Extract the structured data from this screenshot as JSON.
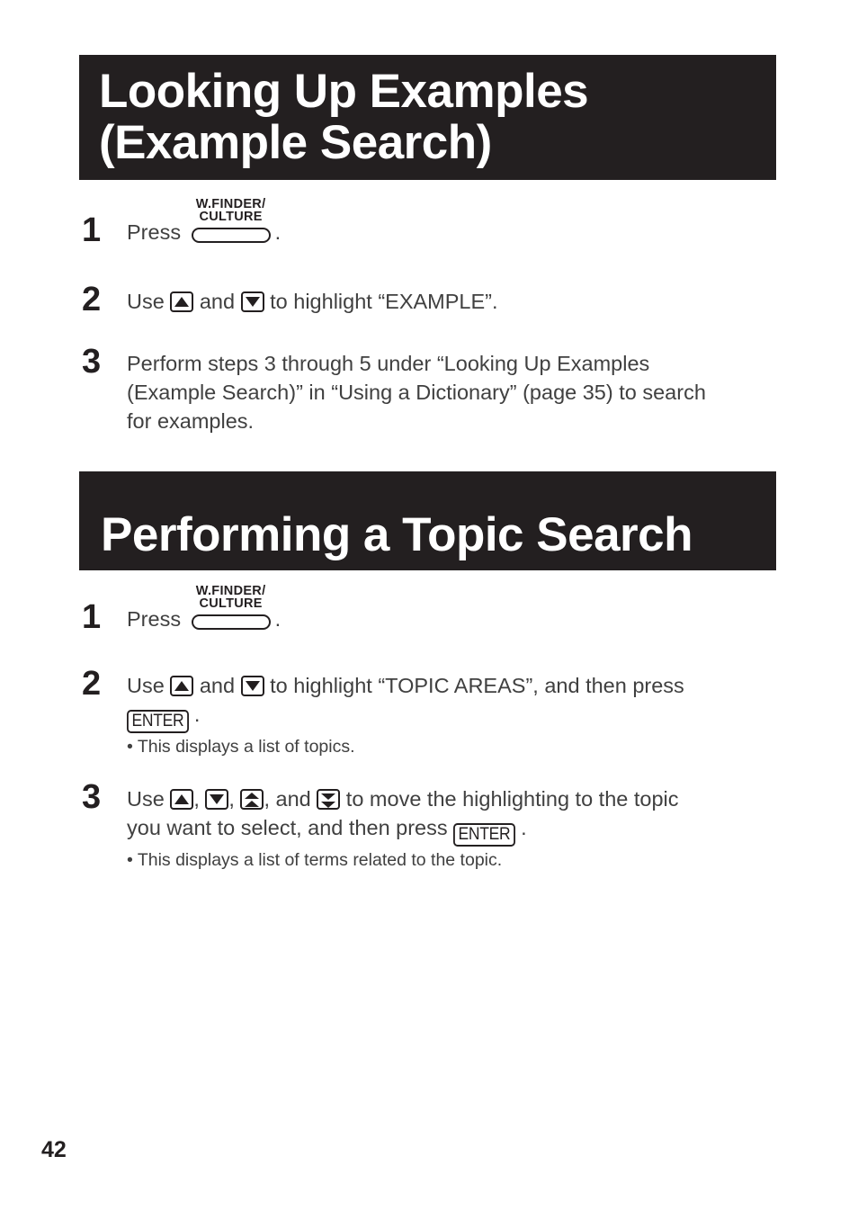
{
  "page": {
    "number": "42",
    "banner_color": "#231f20",
    "text_color": "#404040"
  },
  "sections": [
    {
      "heading_line_1": "Looking Up Examples",
      "heading_line_2": "(Example Search)"
    },
    {
      "heading_line_1": "Performing a Topic Search"
    }
  ],
  "section1_steps": {
    "step1": {
      "num": "1",
      "press_label": "Press",
      "key": {
        "line1": "W.FINDER/",
        "line2": "CULTURE"
      },
      "period": "."
    },
    "step2": {
      "num": "2",
      "t1": "Use",
      "t2": "and",
      "t3": "to highlight “EXAMPLE”."
    },
    "step3": {
      "num": "3",
      "line1": "Perform steps 3 through 5 under “Looking Up Examples",
      "line2": "(Example Search)” in “Using a Dictionary” (page 35) to search",
      "line3": "for examples."
    }
  },
  "section2_steps": {
    "step1": {
      "num": "1",
      "press_label": "Press",
      "key": {
        "line1": "W.FINDER/",
        "line2": "CULTURE"
      },
      "period": "."
    },
    "step2": {
      "num": "2",
      "t1": "Use",
      "t2": "and",
      "t3": "to highlight “TOPIC AREAS”, and then press",
      "enter_label": "ENTER",
      "t4": ".",
      "bullet": "This displays a list of topics."
    },
    "step3": {
      "num": "3",
      "t1": "Use",
      "t2": ",",
      "t3": ",",
      "t4": ", and",
      "t5": "to move the highlighting to the topic",
      "line2_a": "you want to select, and then press",
      "enter_label": "ENTER",
      "line2_b": ".",
      "bullet": "This displays a list of terms related to the topic."
    }
  },
  "icons": {
    "arrow_up": "arrow-up-icon",
    "arrow_down": "arrow-down-icon",
    "page_up": "page-up-icon",
    "page_down": "page-down-icon",
    "bullet": "•"
  }
}
